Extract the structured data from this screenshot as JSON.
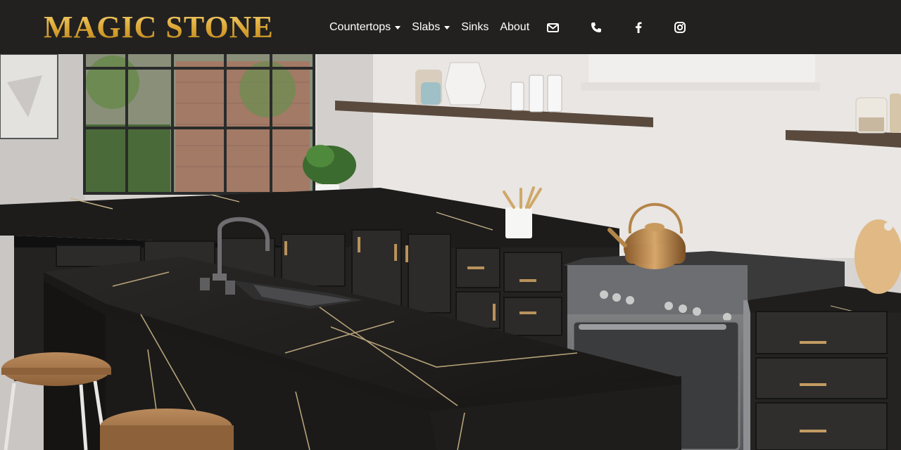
{
  "brand": {
    "name": "MAGIC STONE"
  },
  "nav": {
    "items": [
      {
        "label": "Countertops",
        "dropdown": true
      },
      {
        "label": "Slabs",
        "dropdown": true
      },
      {
        "label": "Sinks",
        "dropdown": false
      },
      {
        "label": "About",
        "dropdown": false
      }
    ],
    "icons": [
      "envelope-icon",
      "phone-icon",
      "facebook-icon",
      "instagram-icon"
    ]
  },
  "hero": {
    "description": "kitchen-with-black-marble-countertops"
  },
  "colors": {
    "navbar_bg": "#222120",
    "brand_gold": "#d9a431",
    "nav_text": "#ffffff"
  }
}
